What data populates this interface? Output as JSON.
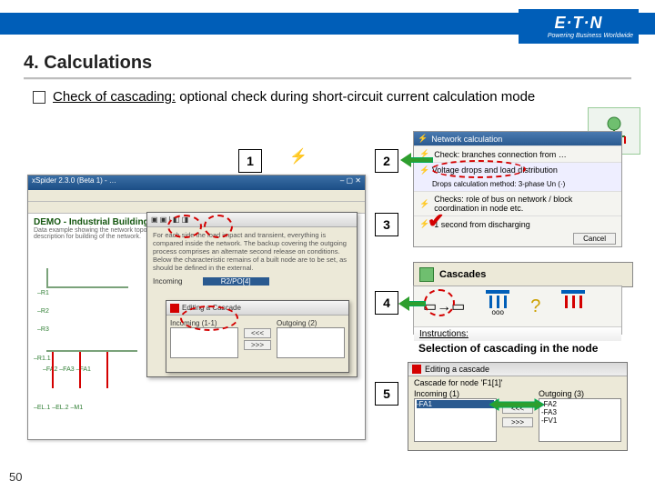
{
  "header": {
    "brand": "E·T·N",
    "tagline": "Powering Business Worldwide"
  },
  "title": "4. Calculations",
  "bullet": {
    "lead_underlined": "Check of cascading:",
    "lead_rest": " optional check during short-circuit current calculation mode"
  },
  "steps": {
    "s1": "1",
    "s2": "2",
    "s3": "3",
    "s4": "4",
    "s5": "5"
  },
  "screenshot_main": {
    "window_title": "xSpider 2.3.0 (Beta 1) - …",
    "doc_title": "DEMO - Industrial Building Supply",
    "doc_desc": "Data example showing the network topology generation. Program documentation includes a step by step description for building of the network.",
    "dialog_title": "Editing a Cascade",
    "incoming_label": "Incoming",
    "outgoing_label": "Outgoing (2)",
    "node_ref": "R2/PO[4]"
  },
  "panel_calc": {
    "title": "Network calculation",
    "row1": "Check: branches connection from …",
    "row2": "Voltage drops and load distribution",
    "row2b": "Drops calculation method:  3-phase Un  (·)",
    "row3": "Checks: role of bus on network / block coordination in node etc.",
    "row4": "1 second from discharging",
    "cancel": "Cancel"
  },
  "cascades": {
    "label": "Cascades"
  },
  "instruction_line": "Instructions:",
  "selection_caption": "Selection of cascading in the node",
  "edit_cascade": {
    "title": "Editing a cascade",
    "subtitle": "Cascade for node 'F1[1]'",
    "incoming": "Incoming (1)",
    "outgoing": "Outgoing (3)",
    "in_item": "-FA1",
    "out1": "-FA2",
    "out2": "-FA3",
    "out3": "-FV1",
    "btn_left": "<<<",
    "btn_right": ">>>"
  },
  "page_number": "50"
}
